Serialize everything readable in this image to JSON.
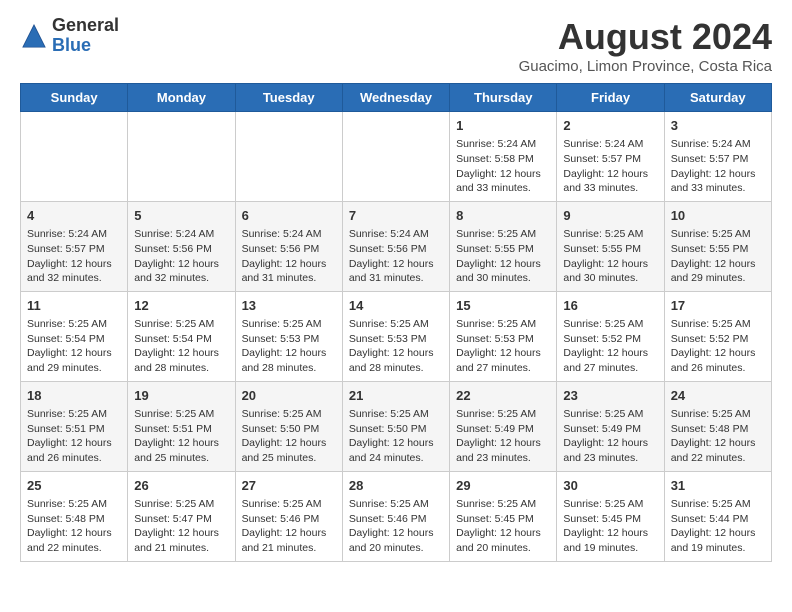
{
  "logo": {
    "general": "General",
    "blue": "Blue"
  },
  "title": {
    "month_year": "August 2024",
    "location": "Guacimo, Limon Province, Costa Rica"
  },
  "days_of_week": [
    "Sunday",
    "Monday",
    "Tuesday",
    "Wednesday",
    "Thursday",
    "Friday",
    "Saturday"
  ],
  "weeks": [
    [
      {
        "day": "",
        "info": ""
      },
      {
        "day": "",
        "info": ""
      },
      {
        "day": "",
        "info": ""
      },
      {
        "day": "",
        "info": ""
      },
      {
        "day": "1",
        "info": "Sunrise: 5:24 AM\nSunset: 5:58 PM\nDaylight: 12 hours and 33 minutes."
      },
      {
        "day": "2",
        "info": "Sunrise: 5:24 AM\nSunset: 5:57 PM\nDaylight: 12 hours and 33 minutes."
      },
      {
        "day": "3",
        "info": "Sunrise: 5:24 AM\nSunset: 5:57 PM\nDaylight: 12 hours and 33 minutes."
      }
    ],
    [
      {
        "day": "4",
        "info": "Sunrise: 5:24 AM\nSunset: 5:57 PM\nDaylight: 12 hours and 32 minutes."
      },
      {
        "day": "5",
        "info": "Sunrise: 5:24 AM\nSunset: 5:56 PM\nDaylight: 12 hours and 32 minutes."
      },
      {
        "day": "6",
        "info": "Sunrise: 5:24 AM\nSunset: 5:56 PM\nDaylight: 12 hours and 31 minutes."
      },
      {
        "day": "7",
        "info": "Sunrise: 5:24 AM\nSunset: 5:56 PM\nDaylight: 12 hours and 31 minutes."
      },
      {
        "day": "8",
        "info": "Sunrise: 5:25 AM\nSunset: 5:55 PM\nDaylight: 12 hours and 30 minutes."
      },
      {
        "day": "9",
        "info": "Sunrise: 5:25 AM\nSunset: 5:55 PM\nDaylight: 12 hours and 30 minutes."
      },
      {
        "day": "10",
        "info": "Sunrise: 5:25 AM\nSunset: 5:55 PM\nDaylight: 12 hours and 29 minutes."
      }
    ],
    [
      {
        "day": "11",
        "info": "Sunrise: 5:25 AM\nSunset: 5:54 PM\nDaylight: 12 hours and 29 minutes."
      },
      {
        "day": "12",
        "info": "Sunrise: 5:25 AM\nSunset: 5:54 PM\nDaylight: 12 hours and 28 minutes."
      },
      {
        "day": "13",
        "info": "Sunrise: 5:25 AM\nSunset: 5:53 PM\nDaylight: 12 hours and 28 minutes."
      },
      {
        "day": "14",
        "info": "Sunrise: 5:25 AM\nSunset: 5:53 PM\nDaylight: 12 hours and 28 minutes."
      },
      {
        "day": "15",
        "info": "Sunrise: 5:25 AM\nSunset: 5:53 PM\nDaylight: 12 hours and 27 minutes."
      },
      {
        "day": "16",
        "info": "Sunrise: 5:25 AM\nSunset: 5:52 PM\nDaylight: 12 hours and 27 minutes."
      },
      {
        "day": "17",
        "info": "Sunrise: 5:25 AM\nSunset: 5:52 PM\nDaylight: 12 hours and 26 minutes."
      }
    ],
    [
      {
        "day": "18",
        "info": "Sunrise: 5:25 AM\nSunset: 5:51 PM\nDaylight: 12 hours and 26 minutes."
      },
      {
        "day": "19",
        "info": "Sunrise: 5:25 AM\nSunset: 5:51 PM\nDaylight: 12 hours and 25 minutes."
      },
      {
        "day": "20",
        "info": "Sunrise: 5:25 AM\nSunset: 5:50 PM\nDaylight: 12 hours and 25 minutes."
      },
      {
        "day": "21",
        "info": "Sunrise: 5:25 AM\nSunset: 5:50 PM\nDaylight: 12 hours and 24 minutes."
      },
      {
        "day": "22",
        "info": "Sunrise: 5:25 AM\nSunset: 5:49 PM\nDaylight: 12 hours and 23 minutes."
      },
      {
        "day": "23",
        "info": "Sunrise: 5:25 AM\nSunset: 5:49 PM\nDaylight: 12 hours and 23 minutes."
      },
      {
        "day": "24",
        "info": "Sunrise: 5:25 AM\nSunset: 5:48 PM\nDaylight: 12 hours and 22 minutes."
      }
    ],
    [
      {
        "day": "25",
        "info": "Sunrise: 5:25 AM\nSunset: 5:48 PM\nDaylight: 12 hours and 22 minutes."
      },
      {
        "day": "26",
        "info": "Sunrise: 5:25 AM\nSunset: 5:47 PM\nDaylight: 12 hours and 21 minutes."
      },
      {
        "day": "27",
        "info": "Sunrise: 5:25 AM\nSunset: 5:46 PM\nDaylight: 12 hours and 21 minutes."
      },
      {
        "day": "28",
        "info": "Sunrise: 5:25 AM\nSunset: 5:46 PM\nDaylight: 12 hours and 20 minutes."
      },
      {
        "day": "29",
        "info": "Sunrise: 5:25 AM\nSunset: 5:45 PM\nDaylight: 12 hours and 20 minutes."
      },
      {
        "day": "30",
        "info": "Sunrise: 5:25 AM\nSunset: 5:45 PM\nDaylight: 12 hours and 19 minutes."
      },
      {
        "day": "31",
        "info": "Sunrise: 5:25 AM\nSunset: 5:44 PM\nDaylight: 12 hours and 19 minutes."
      }
    ]
  ]
}
